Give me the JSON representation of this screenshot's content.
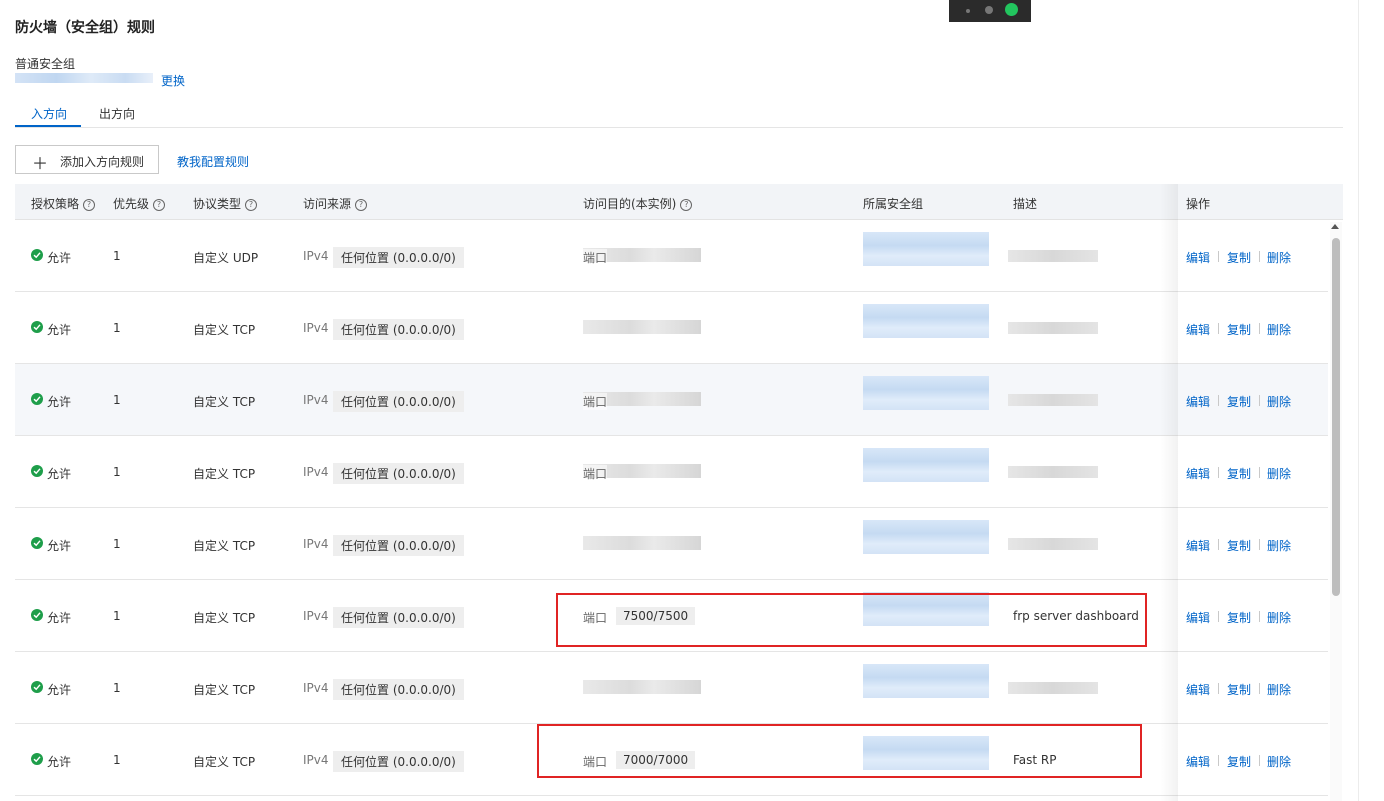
{
  "header": {
    "title": "防火墙（安全组）规则",
    "sg_type": "普通安全组",
    "change_label": "更换"
  },
  "tabs": [
    {
      "label": "入方向",
      "active": true
    },
    {
      "label": "出方向",
      "active": false
    }
  ],
  "toolbar": {
    "add_label": "添加入方向规则",
    "help_link": "教我配置规则"
  },
  "table": {
    "columns": {
      "policy": "授权策略",
      "priority": "优先级",
      "protocol": "协议类型",
      "source": "访问来源",
      "dest": "访问目的(本实例)",
      "group": "所属安全组",
      "desc": "描述",
      "ops": "操作"
    },
    "actions": {
      "edit": "编辑",
      "copy": "复制",
      "delete": "删除"
    },
    "rows": [
      {
        "policy": "允许",
        "priority": "1",
        "protocol": "自定义 UDP",
        "ip_type": "IPv4",
        "source": "任何位置 (0.0.0.0/0)",
        "port_label": "端口",
        "port": "",
        "desc": ""
      },
      {
        "policy": "允许",
        "priority": "1",
        "protocol": "自定义 TCP",
        "ip_type": "IPv4",
        "source": "任何位置 (0.0.0.0/0)",
        "port_label": "",
        "port": "",
        "desc": ""
      },
      {
        "policy": "允许",
        "priority": "1",
        "protocol": "自定义 TCP",
        "ip_type": "IPv4",
        "source": "任何位置 (0.0.0.0/0)",
        "port_label": "端口",
        "port": "",
        "desc": ""
      },
      {
        "policy": "允许",
        "priority": "1",
        "protocol": "自定义 TCP",
        "ip_type": "IPv4",
        "source": "任何位置 (0.0.0.0/0)",
        "port_label": "端口",
        "port": "",
        "desc": ""
      },
      {
        "policy": "允许",
        "priority": "1",
        "protocol": "自定义 TCP",
        "ip_type": "IPv4",
        "source": "任何位置 (0.0.0.0/0)",
        "port_label": "",
        "port": "",
        "desc": ""
      },
      {
        "policy": "允许",
        "priority": "1",
        "protocol": "自定义 TCP",
        "ip_type": "IPv4",
        "source": "任何位置 (0.0.0.0/0)",
        "port_label": "端口",
        "port": "7500/7500",
        "desc": "frp server dashboard"
      },
      {
        "policy": "允许",
        "priority": "1",
        "protocol": "自定义 TCP",
        "ip_type": "IPv4",
        "source": "任何位置 (0.0.0.0/0)",
        "port_label": "",
        "port": "",
        "desc": ""
      },
      {
        "policy": "允许",
        "priority": "1",
        "protocol": "自定义 TCP",
        "ip_type": "IPv4",
        "source": "任何位置 (0.0.0.0/0)",
        "port_label": "端口",
        "port": "7000/7000",
        "desc": "Fast RP"
      }
    ]
  },
  "colors": {
    "link": "#0064c8",
    "allow": "#1e9e4a",
    "highlight_box": "#e02424",
    "status_green": "#22c55e"
  }
}
